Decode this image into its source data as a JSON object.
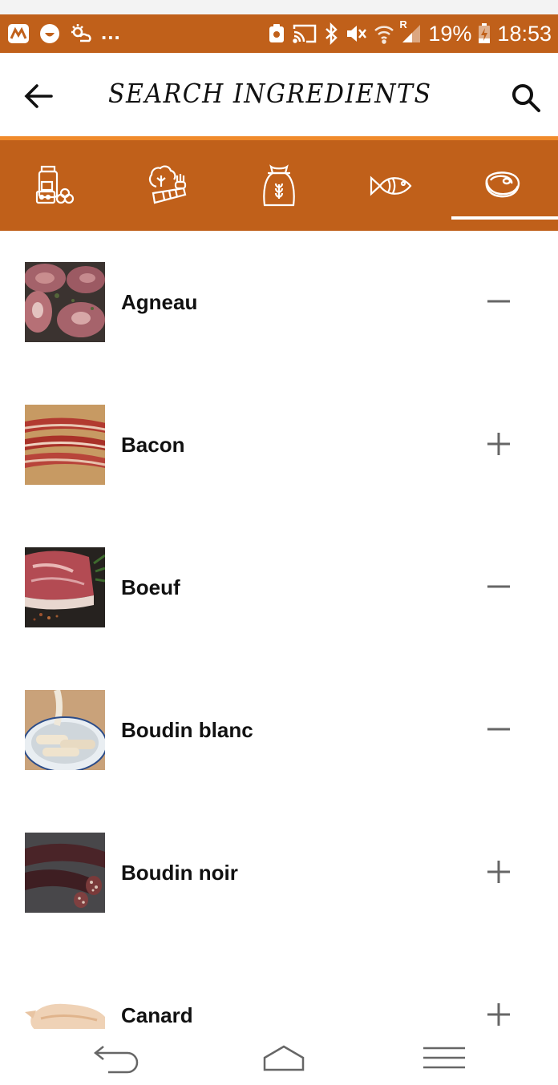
{
  "status_bar": {
    "battery": "19%",
    "time": "18:53",
    "overflow": "...",
    "roaming": "R",
    "icons_left": [
      "app-logo-icon",
      "smiley-icon",
      "weather-icon"
    ],
    "icons_right": [
      "screenshot-icon",
      "cast-icon",
      "bluetooth-icon",
      "mute-icon",
      "wifi-icon",
      "signal-icon",
      "battery-charging-icon"
    ]
  },
  "app_bar": {
    "title": "SEARCH INGREDIENTS"
  },
  "tabs": [
    {
      "icon": "pantry-icon",
      "selected": false
    },
    {
      "icon": "vegetables-icon",
      "selected": false
    },
    {
      "icon": "grain-sack-icon",
      "selected": false
    },
    {
      "icon": "fish-icon",
      "selected": false
    },
    {
      "icon": "meat-icon",
      "selected": true
    }
  ],
  "ingredients": [
    {
      "name": "Agneau",
      "action": "remove",
      "thumb_icon": "lamb-photo"
    },
    {
      "name": "Bacon",
      "action": "add",
      "thumb_icon": "bacon-photo"
    },
    {
      "name": "Boeuf",
      "action": "remove",
      "thumb_icon": "beef-photo"
    },
    {
      "name": "Boudin blanc",
      "action": "remove",
      "thumb_icon": "boudin-blanc-photo"
    },
    {
      "name": "Boudin noir",
      "action": "add",
      "thumb_icon": "boudin-noir-photo"
    },
    {
      "name": "Canard",
      "action": "add",
      "thumb_icon": "duck-photo"
    }
  ],
  "nav_bar": {
    "icons": [
      "back-nav-icon",
      "home-nav-icon",
      "recents-nav-icon"
    ]
  },
  "colors": {
    "primary": "#c0601a",
    "accent": "#f08a2b",
    "control": "#666666"
  }
}
